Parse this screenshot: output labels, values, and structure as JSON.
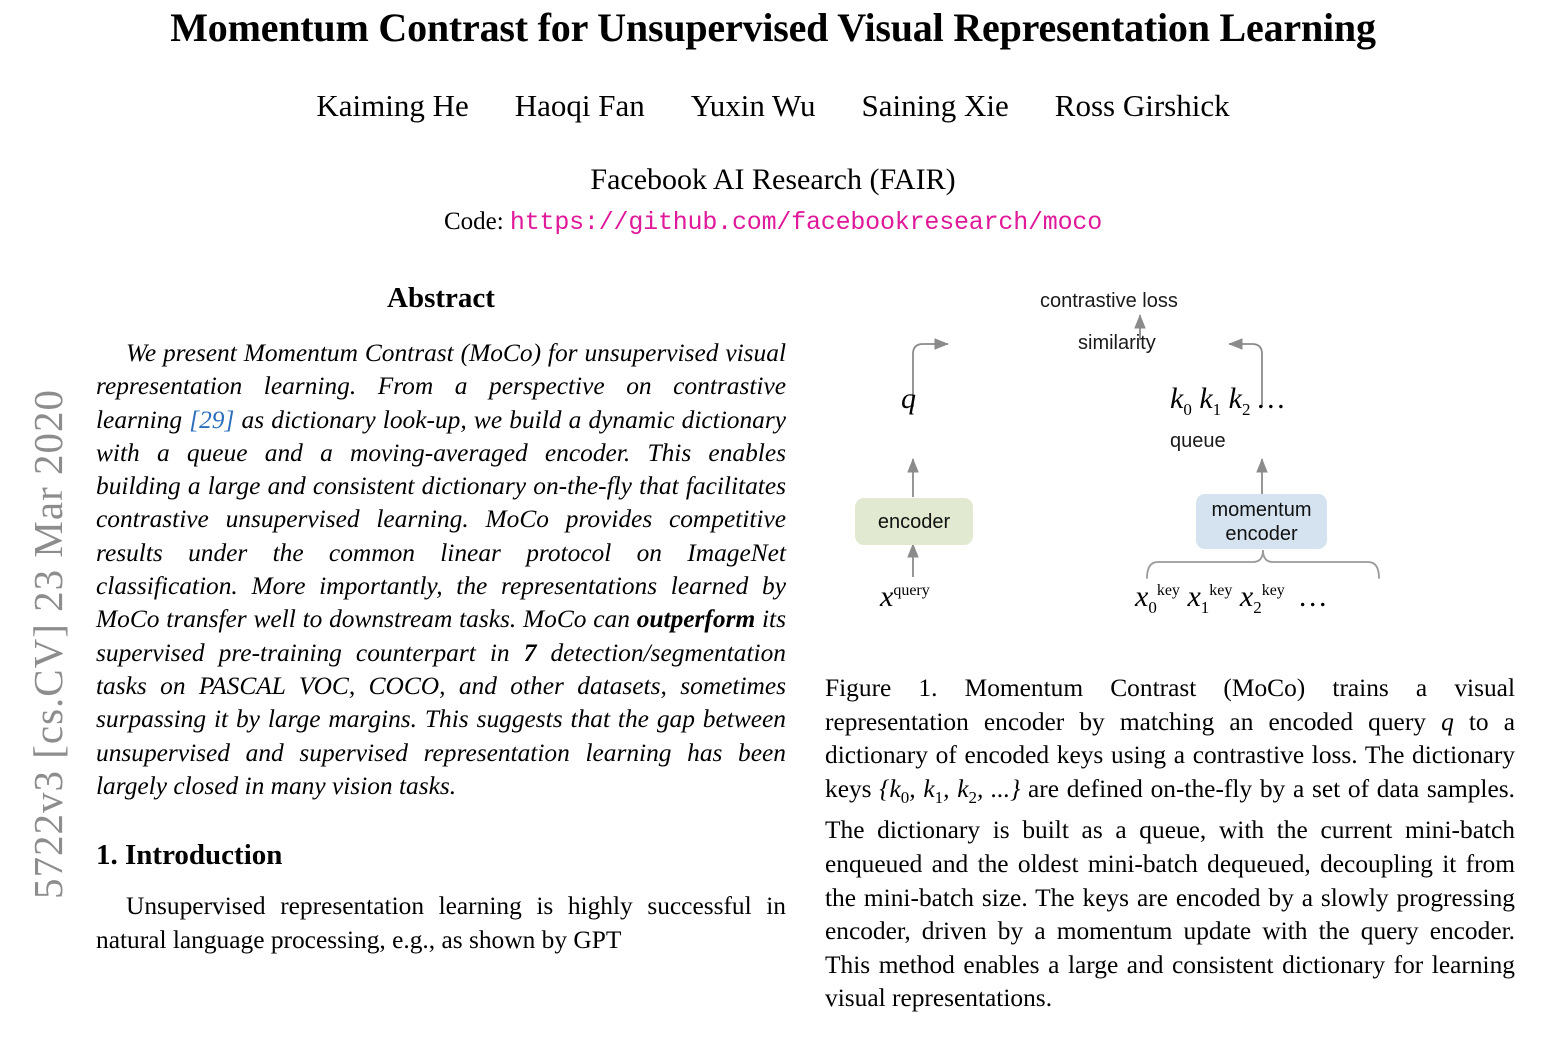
{
  "arxiv_stamp": "5722v3  [cs.CV]  23 Mar 2020",
  "header": {
    "title": "Momentum Contrast for Unsupervised Visual Representation Learning",
    "authors": [
      "Kaiming He",
      "Haoqi Fan",
      "Yuxin Wu",
      "Saining Xie",
      "Ross Girshick"
    ],
    "affiliation": "Facebook AI Research (FAIR)",
    "code_label": "Code:",
    "code_url": "https://github.com/facebookresearch/moco",
    "code_url_color": "#e0189a"
  },
  "left_column": {
    "abstract_heading": "Abstract",
    "abstract": {
      "part1": "We present Momentum Contrast (MoCo) for unsupervised visual representation learning. From a perspective on contrastive learning ",
      "citation": "[29]",
      "citation_color": "#2a6ebb",
      "part2": " as dictionary look-up, we build a dynamic dictionary with a queue and a moving-averaged encoder. This enables building a large and consistent dictionary on-the-fly that facilitates contrastive unsupervised learning. MoCo provides competitive results under the common linear protocol on ImageNet classification. More importantly, the representations learned by MoCo transfer well to downstream tasks. MoCo can ",
      "bold1": "outperform",
      "part3": " its supervised pre-training counterpart in ",
      "bold2": "7",
      "part4": " detection/segmentation tasks on PASCAL VOC, COCO, and other datasets, sometimes surpassing it by large margins. This suggests that the gap between unsupervised and supervised representation learning has been largely closed in many vision tasks."
    },
    "intro_heading": "1. Introduction",
    "intro_text": "Unsupervised representation learning is highly successful in natural language processing, e.g., as shown by GPT"
  },
  "right_column": {
    "figure": {
      "contrastive_loss_label": "contrastive loss",
      "similarity_label": "similarity",
      "q_symbol": "q",
      "keys": [
        "k",
        "k",
        "k"
      ],
      "key_subscripts": [
        "0",
        "1",
        "2"
      ],
      "keys_ellipsis": "…",
      "queue_label": "queue",
      "encoder_box_label": "encoder",
      "encoder_box_color": "#e1e9d1",
      "momentum_encoder_box_label_line1": "momentum",
      "momentum_encoder_box_label_line2": "encoder",
      "momentum_encoder_box_color": "#d4e3ef",
      "x_query_base": "x",
      "x_query_sup": "query",
      "x_key_base": "x",
      "x_key_sup": "key",
      "x_key_subs": [
        "0",
        "1",
        "2"
      ],
      "x_keys_ellipsis": "…",
      "arrow_color": "#808080"
    },
    "caption": {
      "p1": "Figure 1. Momentum Contrast (MoCo) trains a visual representation encoder by matching an encoded query ",
      "m1": "q",
      "p2": " to a dictionary of encoded keys using a contrastive loss. The dictionary keys ",
      "m2_open": "{",
      "m2_k0": "k",
      "m2_s0": "0",
      "m2_c1": ", ",
      "m2_k1": "k",
      "m2_s1": "1",
      "m2_c2": ", ",
      "m2_k2": "k",
      "m2_s2": "2",
      "m2_tail": ", ...}",
      "p3": " are defined on-the-fly by a set of data samples. The dictionary is built as a queue, with the current mini-batch enqueued and the oldest mini-batch dequeued, decoupling it from the mini-batch size. The keys are encoded by a slowly progressing encoder, driven by a momentum update with the query encoder. This method enables a large and consistent dictionary for learning visual representations."
    }
  }
}
